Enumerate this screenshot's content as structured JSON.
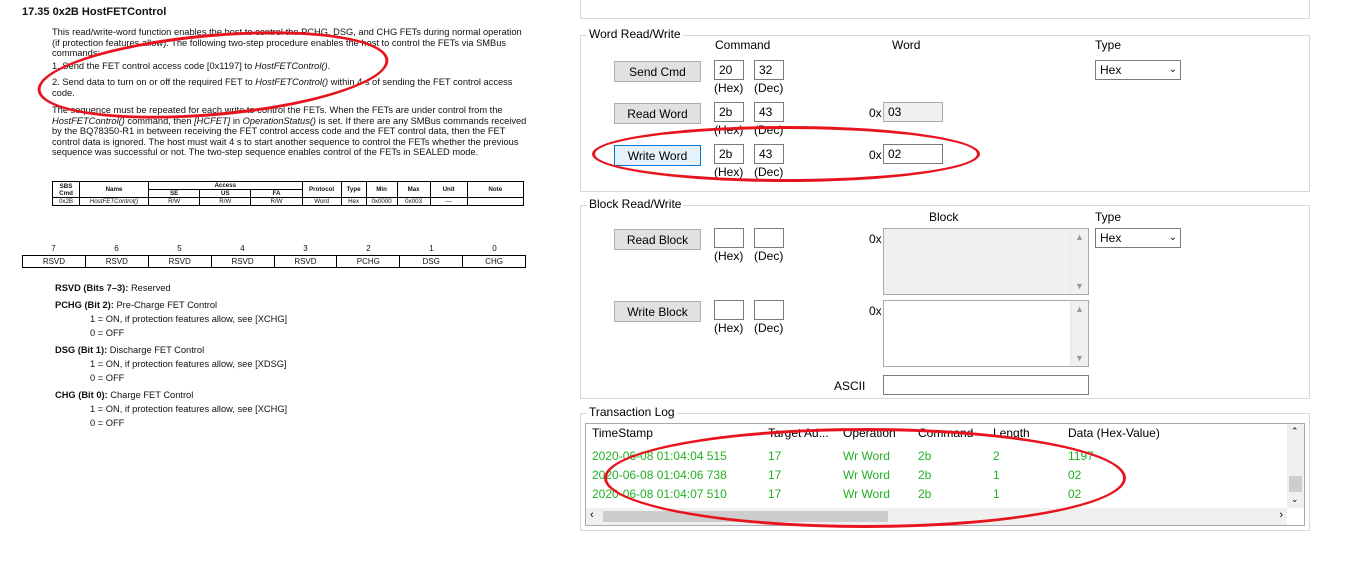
{
  "doc": {
    "section_title": "17.35   0x2B HostFETControl",
    "intro": "This read/write-word function enables the host to control the PCHG, DSG, and CHG FETs during normal operation (if protection features allow). The following two-step procedure enables the host to control the FETs via SMBus commands:",
    "step1_pre": "1.  Send the FET control access code [0x1197] to ",
    "step1_em": "HostFETControl()",
    "step1_post": ".",
    "step2_pre": "2.  Send data to turn on or off the required FET to ",
    "step2_em": "HostFETControl()",
    "step2_post": " within 4 s of sending the FET control access code.",
    "para1_a": "The sequence must be repeated for each write to control the FETs. When the FETs are under control from the ",
    "para1_em1": "HostFETControl()",
    "para1_b": " command, then ",
    "para1_em2": "[HCFET]",
    "para1_c": " in ",
    "para1_em3": "OperationStatus()",
    "para1_d": " is set. If there are any SMBus commands received by the BQ78350-R1 in between receiving the FET control access code and the FET control data, then the FET control data is ignored. The host must wait 4 s to start another sequence to control the FETs whether the previous sequence was successful or not. The two-step sequence enables control of the FETs in SEALED mode.",
    "table": {
      "h_sbs": "SBS Cmd",
      "h_name": "Name",
      "h_access": "Access",
      "h_se": "SE",
      "h_us": "US",
      "h_fa": "FA",
      "h_protocol": "Protocol",
      "h_type": "Type",
      "h_min": "Min",
      "h_max": "Max",
      "h_unit": "Unit",
      "h_note": "Note",
      "r_sbs": "0x2B",
      "r_name": "HostFETControl()",
      "r_se": "R/W",
      "r_us": "R/W",
      "r_fa": "R/W",
      "r_protocol": "Word",
      "r_type": "Hex",
      "r_min": "0x0000",
      "r_max": "0x003",
      "r_unit": "—",
      "r_note": ""
    },
    "bit_numbers": [
      "7",
      "6",
      "5",
      "4",
      "3",
      "2",
      "1",
      "0"
    ],
    "bit_names": [
      "RSVD",
      "RSVD",
      "RSVD",
      "RSVD",
      "RSVD",
      "PCHG",
      "DSG",
      "CHG"
    ],
    "rsvd_b": "RSVD (Bits 7–3):",
    "rsvd_t": " Reserved",
    "pchg_b": "PCHG (Bit 2):",
    "pchg_t": " Pre-Charge FET Control",
    "pchg_1": "1 =  ON, if protection features allow, see [XCHG]",
    "pchg_0": "0 =  OFF",
    "dsg_b": "DSG (Bit 1):",
    "dsg_t": " Discharge FET Control",
    "dsg_1": "1 =  ON, if protection features allow, see [XDSG]",
    "dsg_0": "0 =  OFF",
    "chg_b": "CHG (Bit 0):",
    "chg_t": " Charge FET Control",
    "chg_1": "1 =  ON, if protection features allow, see [XCHG]",
    "chg_0": "0 =  OFF"
  },
  "word_rw": {
    "title": "Word Read/Write",
    "col_command": "Command",
    "col_word": "Word",
    "col_type": "Type",
    "send_cmd_label": "Send Cmd",
    "send_cmd_hex": "20",
    "send_cmd_dec": "32",
    "read_word_label": "Read Word",
    "read_hex": "2b",
    "read_dec": "43",
    "read_value": "03",
    "write_word_label": "Write Word",
    "write_hex": "2b",
    "write_dec": "43",
    "write_value": "02",
    "hex_caption": "(Hex)",
    "dec_caption": "(Dec)",
    "prefix_0x": "0x",
    "type_value": "Hex"
  },
  "block_rw": {
    "title": "Block Read/Write",
    "col_block": "Block",
    "col_type": "Type",
    "read_block_label": "Read Block",
    "write_block_label": "Write Block",
    "hex_caption": "(Hex)",
    "dec_caption": "(Dec)",
    "prefix_0x": "0x",
    "type_value": "Hex",
    "ascii_label": "ASCII"
  },
  "log": {
    "title": "Transaction Log",
    "headers": [
      "TimeStamp",
      "Target Ad...",
      "Operation",
      "Command",
      "Length",
      "Data (Hex-Value)"
    ],
    "rows": [
      [
        "2020-06-08 01:04:04 515",
        "17",
        "Wr Word",
        "2b",
        "2",
        "1197"
      ],
      [
        "2020-06-08 01:04:06 738",
        "17",
        "Wr Word",
        "2b",
        "1",
        "02"
      ],
      [
        "2020-06-08 01:04:07 510",
        "17",
        "Wr Word",
        "2b",
        "1",
        "02"
      ]
    ]
  },
  "colors": {
    "annotation_red": "#e8141d",
    "log_green": "#22b022",
    "button_focus": "#0078d7"
  }
}
